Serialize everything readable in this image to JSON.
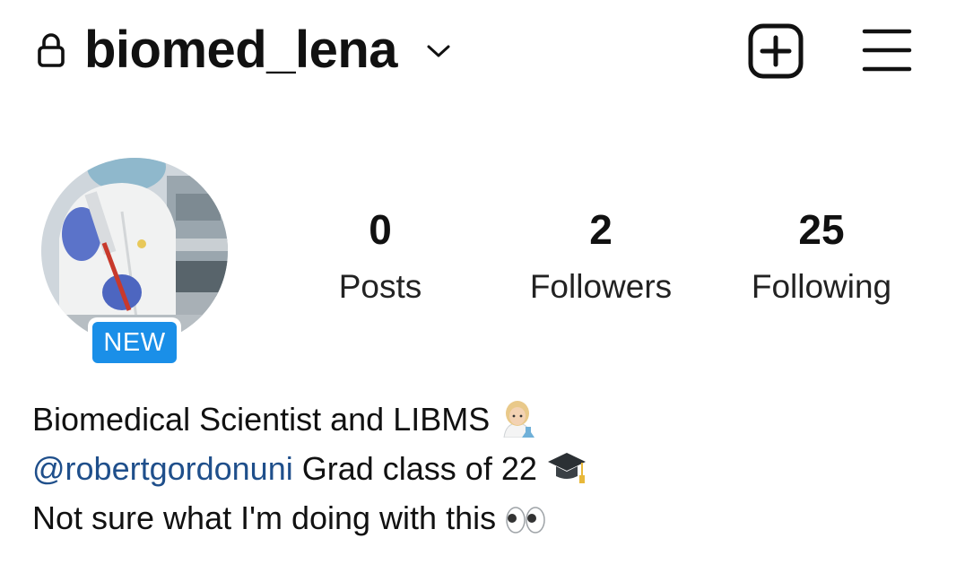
{
  "header": {
    "username": "biomed_lena"
  },
  "profile": {
    "badge_label": "NEW",
    "stats": [
      {
        "value": "0",
        "label": "Posts"
      },
      {
        "value": "2",
        "label": "Followers"
      },
      {
        "value": "25",
        "label": "Following"
      }
    ]
  },
  "bio": {
    "line1": "Biomedical Scientist and LIBMS",
    "line1_emoji": "scientist-emoji",
    "mention": "@robertgordonuni",
    "line2_text": " Grad class of 22",
    "line2_emoji": "graduation-cap-emoji",
    "line3": "Not sure what I'm doing with this",
    "line3_emoji": "eyes-emoji"
  },
  "icons": {
    "lock": "lock-icon",
    "chevron": "chevron-down-icon",
    "new_post": "plus-square-icon",
    "menu": "hamburger-menu-icon"
  },
  "colors": {
    "badge": "#1a8fe8",
    "mention": "#1f4f8b",
    "text": "#111111"
  }
}
